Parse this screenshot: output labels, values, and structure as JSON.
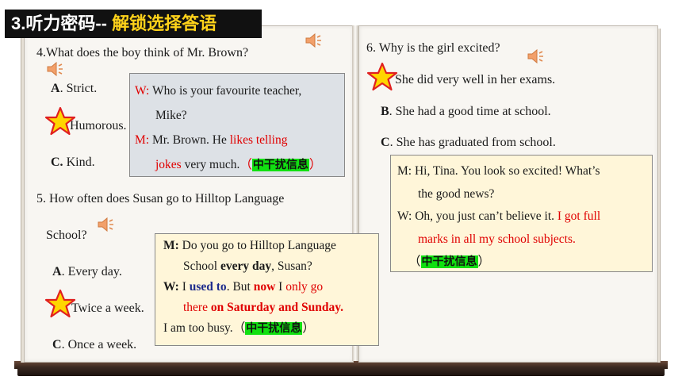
{
  "title": {
    "prefix": "3.听力密码-- ",
    "highlight": "解锁选择答语"
  },
  "left_page": {
    "q4": {
      "question": "4.What does the boy think of Mr. Brown?",
      "options": [
        {
          "letter": "A",
          "text": ". Strict."
        },
        {
          "letter": "",
          "text": "Humorous."
        },
        {
          "letter": "C.",
          "text": " Kind."
        }
      ],
      "dialogue": {
        "l1_speaker": "W:",
        "l1_text": " Who is your favourite teacher,",
        "l2_text": "Mike?",
        "l3_speaker": "M:",
        "l3_text": " Mr. Brown. He ",
        "l3_red": "likes telling",
        "l4_red": "jokes",
        "l4_text": " very much.",
        "l4_open": "（",
        "l4_tag": "中干扰信息",
        "l4_close": "）"
      }
    },
    "q5": {
      "question_line1": "5. How often does Susan go to Hilltop Language",
      "question_line2": "School?",
      "options": [
        {
          "letter": "A",
          "text": ". Every day."
        },
        {
          "letter": "",
          "text": "Twice a week."
        },
        {
          "letter": "C",
          "text": ". Once a week."
        }
      ],
      "dialogue": {
        "l1_speaker": "M:",
        "l1_text": " Do you go to Hilltop Language",
        "l2_text": "School ",
        "l2_bold": "every day",
        "l2_end": ", Susan?",
        "l3_speaker": "W:",
        "l3_text": " I ",
        "l3_bold": "used to",
        "l3_mid": ". But ",
        "l3_now": "now",
        "l3_i": " I ",
        "l3_red": "only go",
        "l4_red": "there ",
        "l4_redb": "on Saturday and Sunday.",
        "l5_text": "I am too busy.",
        "l5_open": "（",
        "l5_tag": "中干扰信息",
        "l5_close": "）"
      }
    }
  },
  "right_page": {
    "q6": {
      "question": "6. Why is the girl excited?",
      "options": [
        {
          "letter": "",
          "text": "She did very well in her exams."
        },
        {
          "letter": "B",
          "text": ". She had a good time at school."
        },
        {
          "letter": "C",
          "text": ". She has graduated from school."
        }
      ],
      "dialogue": {
        "l1": "M: Hi, Tina. You look so excited! What’s",
        "l2": "the good news?",
        "l3_text": "W: Oh, you just can’t believe it. ",
        "l3_red": "I got full",
        "l4_red": "marks in all my school subjects.",
        "l5_open": "（",
        "l5_tag": "中干扰信息",
        "l5_close": "）"
      }
    }
  },
  "icons": [
    "speaker-icon",
    "star-icon"
  ]
}
